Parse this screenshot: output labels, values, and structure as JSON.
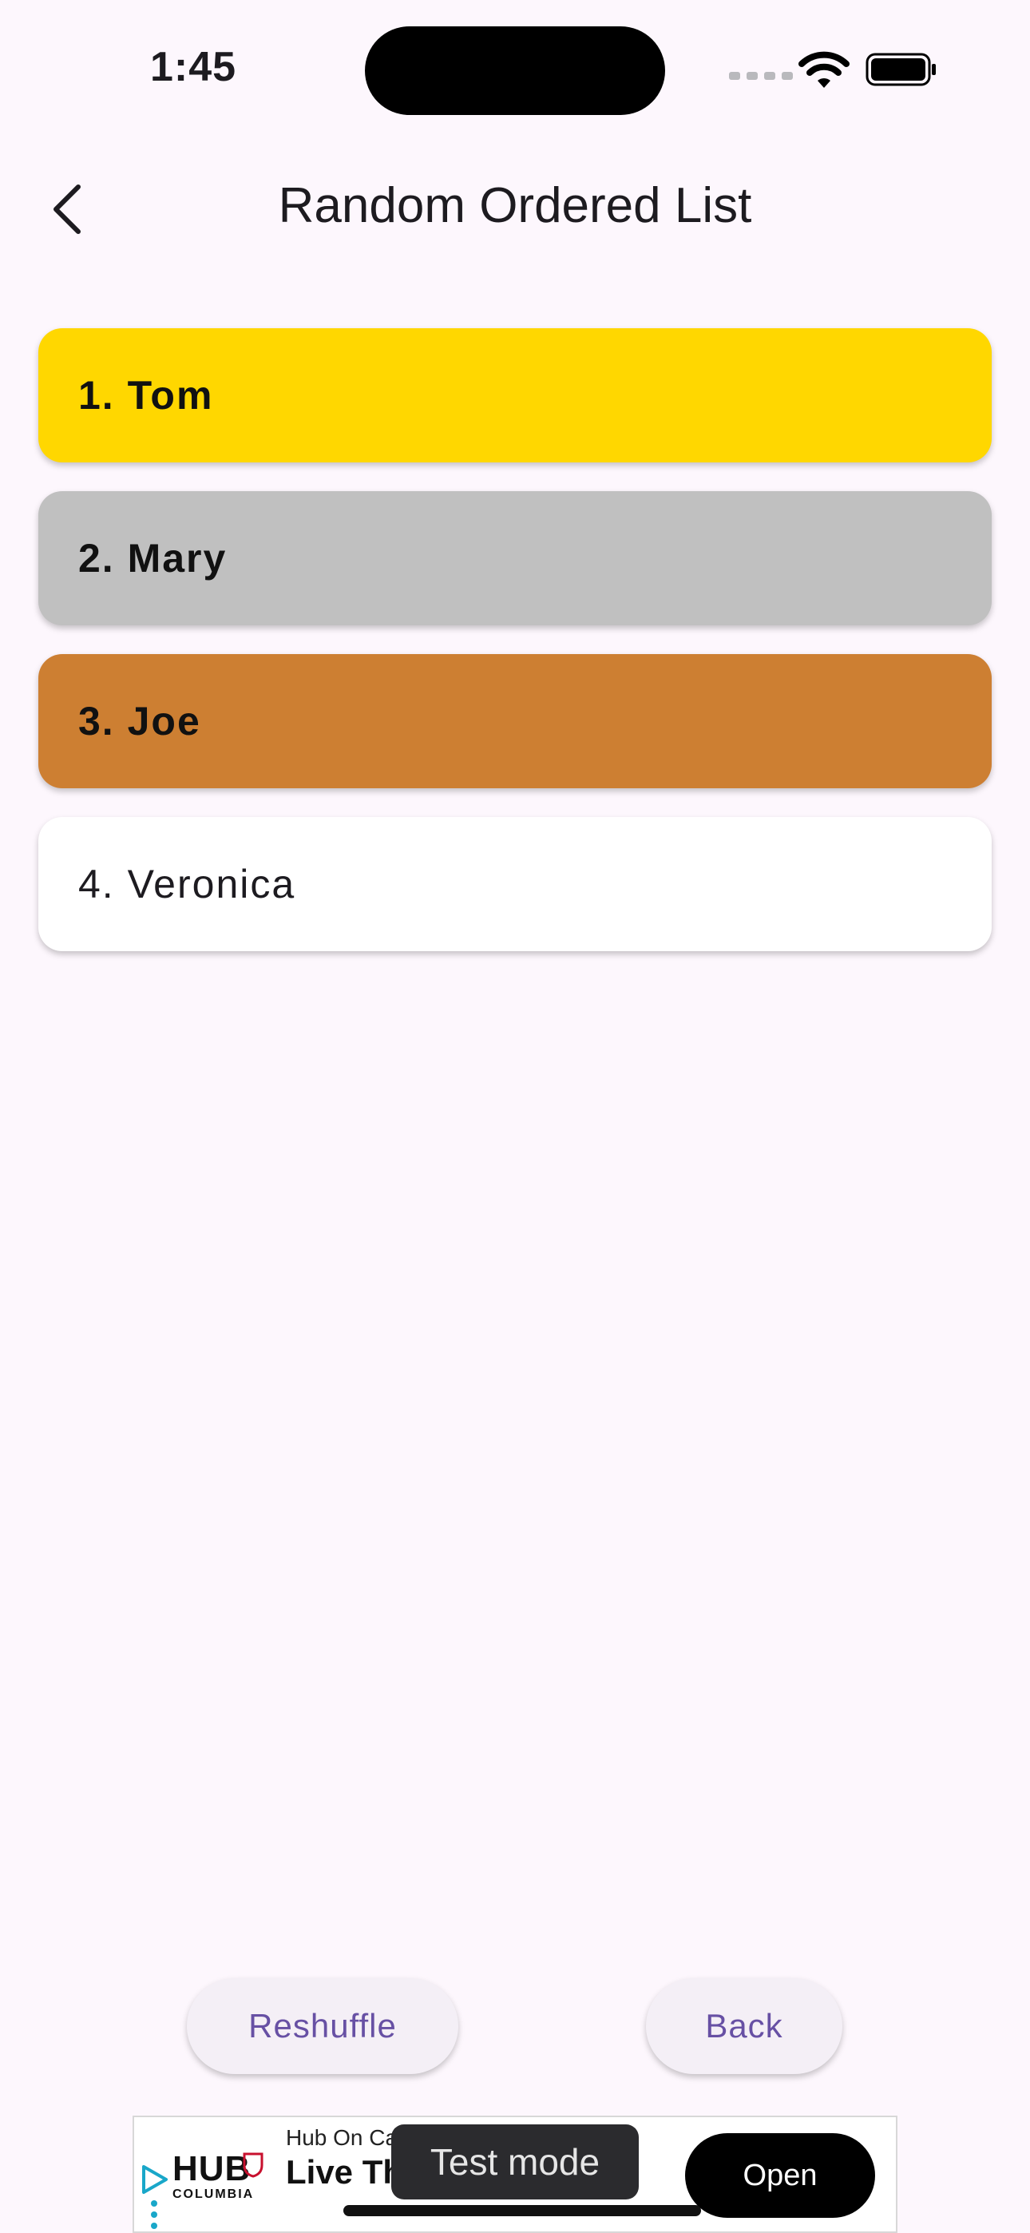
{
  "status_bar": {
    "time": "1:45"
  },
  "header": {
    "title": "Random Ordered List",
    "back_icon": "chevron-left-icon"
  },
  "list": [
    {
      "label": "1. Tom",
      "color": "#FFD700",
      "bold": true
    },
    {
      "label": "2. Mary",
      "color": "#C0C0C0",
      "bold": true
    },
    {
      "label": "3. Joe",
      "color": "#CD7F32",
      "bold": true
    },
    {
      "label": "4. Veronica",
      "color": "#FFFFFF",
      "bold": false
    }
  ],
  "buttons": {
    "reshuffle": "Reshuffle",
    "back": "Back"
  },
  "ad": {
    "logo": "HUB",
    "logo_sub": "COLUMBIA",
    "brand": "Hub On Ca",
    "headline": "Live Th            By Core",
    "cta": "Open",
    "toast": "Test mode"
  },
  "colors": {
    "accent": "#6750a4",
    "background": "#fdf7fd"
  }
}
